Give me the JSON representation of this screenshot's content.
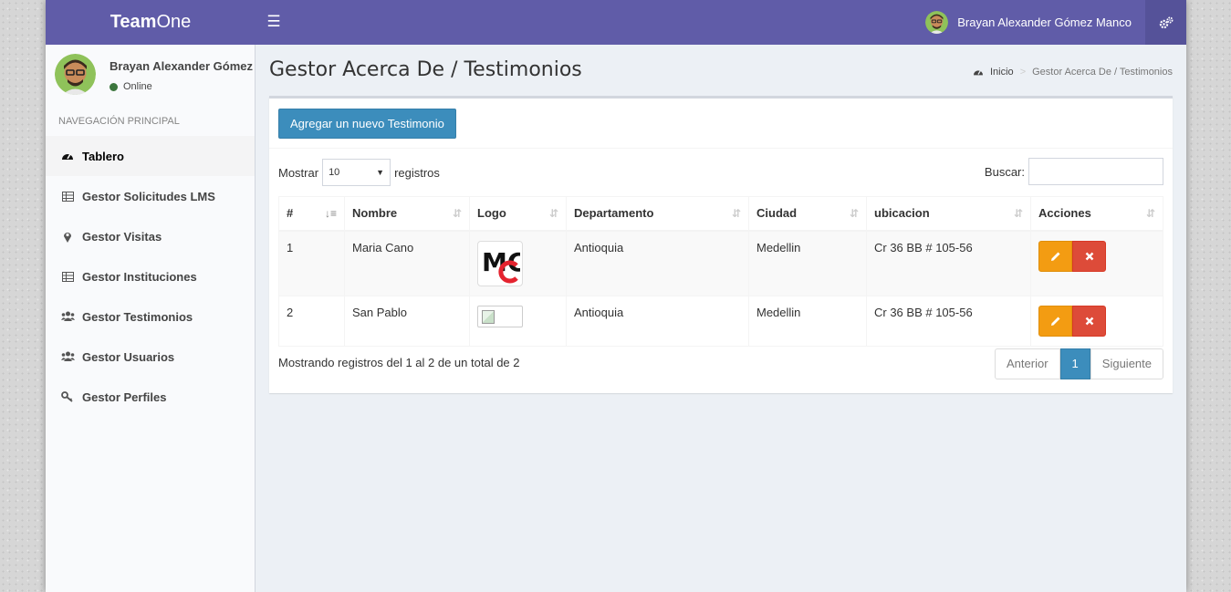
{
  "header": {
    "brand_bold": "Team",
    "brand_light": "One",
    "user_name": "Brayan Alexander Gómez Manco"
  },
  "sidebar": {
    "user_name": "Brayan Alexander Gómez Manco",
    "status": "Online",
    "nav_header": "NAVEGACIÓN PRINCIPAL",
    "items": [
      {
        "label": "Tablero",
        "icon": "dashboard-icon",
        "active": true
      },
      {
        "label": "Gestor Solicitudes LMS",
        "icon": "table-icon"
      },
      {
        "label": "Gestor Visitas",
        "icon": "map-marker-icon"
      },
      {
        "label": "Gestor Instituciones",
        "icon": "table-icon"
      },
      {
        "label": "Gestor Testimonios",
        "icon": "users-icon"
      },
      {
        "label": "Gestor Usuarios",
        "icon": "users-icon"
      },
      {
        "label": "Gestor Perfiles",
        "icon": "key-icon"
      }
    ]
  },
  "page": {
    "title": "Gestor Acerca De / Testimonios",
    "breadcrumb": [
      "Inicio",
      "Gestor Acerca De / Testimonios"
    ]
  },
  "box": {
    "add_button": "Agregar un nuevo Testimonio",
    "length_label_pre": "Mostrar",
    "length_value": "10",
    "length_label_post": "registros",
    "search_label": "Buscar:",
    "search_value": ""
  },
  "table": {
    "columns": [
      "#",
      "Nombre",
      "Logo",
      "Departamento",
      "Ciudad",
      "ubicacion",
      "Acciones"
    ],
    "rows": [
      {
        "id": "1",
        "nombre": "Maria Cano",
        "logo": "MC",
        "departamento": "Antioquia",
        "ciudad": "Medellin",
        "ubicacion": "Cr 36 BB # 105-56"
      },
      {
        "id": "2",
        "nombre": "San Pablo",
        "logo": "",
        "departamento": "Antioquia",
        "ciudad": "Medellin",
        "ubicacion": "Cr 36 BB # 105-56"
      }
    ]
  },
  "footer": {
    "info": "Mostrando registros del 1 al 2 de un total de 2",
    "prev": "Anterior",
    "page": "1",
    "next": "Siguiente"
  },
  "colors": {
    "header": "#605ca8",
    "primary": "#3c8dbc",
    "warning": "#f39c12",
    "danger": "#dd4b39"
  }
}
